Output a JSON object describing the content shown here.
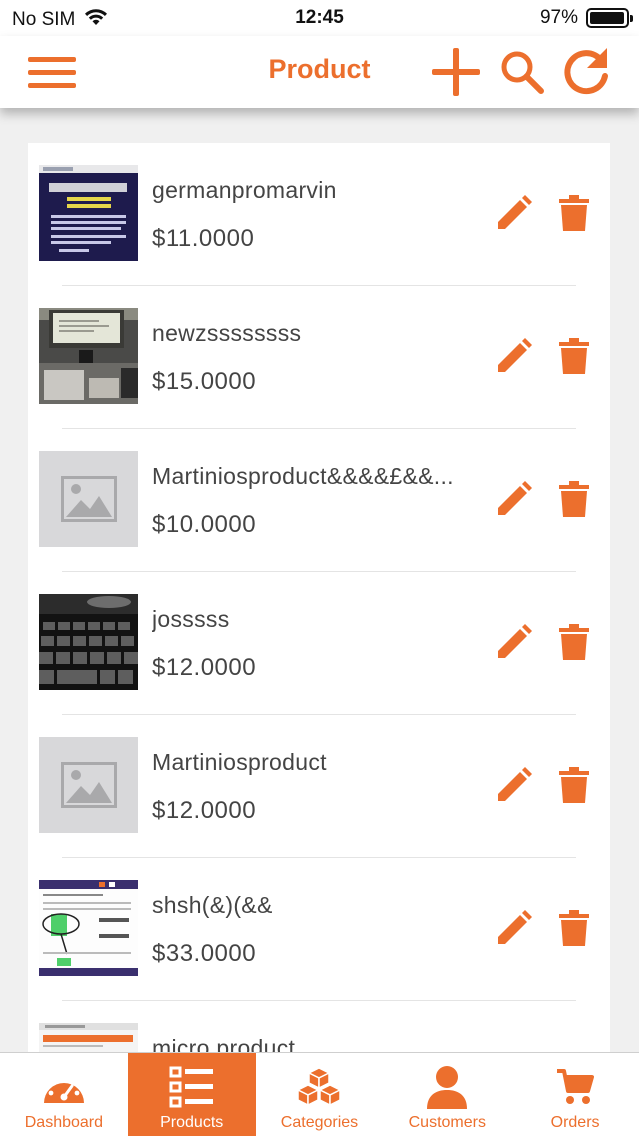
{
  "colors": {
    "accent": "#ec6f2d",
    "text": "#444444",
    "placeholder_bg": "#d8d8da"
  },
  "status_bar": {
    "carrier": "No SIM",
    "time": "12:45",
    "battery": "97%",
    "battery_level": 0.97
  },
  "nav": {
    "title": "Product",
    "icons": [
      "menu-icon",
      "add-icon",
      "search-icon",
      "refresh-icon"
    ]
  },
  "products": [
    {
      "name": "germanpromarvin",
      "price": "$11.0000",
      "image": "screenshot-dark-blue"
    },
    {
      "name": "newzssssssss",
      "price": "$15.0000",
      "image": "photo-monitor-desk"
    },
    {
      "name": "Martiniosproduct&&&&£&&...",
      "price": "$10.0000",
      "image": "placeholder-icon"
    },
    {
      "name": "josssss",
      "price": "$12.0000",
      "image": "photo-keyboard"
    },
    {
      "name": "Martiniosproduct",
      "price": "$12.0000",
      "image": "placeholder-icon"
    },
    {
      "name": "shsh(&)(&&",
      "price": "$33.0000",
      "image": "screenshot-app-drawing"
    },
    {
      "name": "micro product",
      "price": "",
      "image": "screenshot-app"
    }
  ],
  "tabs": [
    {
      "label": "Dashboard",
      "icon": "speedometer-icon",
      "active": false
    },
    {
      "label": "Products",
      "icon": "list-icon",
      "active": true
    },
    {
      "label": "Categories",
      "icon": "boxes-icon",
      "active": false
    },
    {
      "label": "Customers",
      "icon": "person-icon",
      "active": false
    },
    {
      "label": "Orders",
      "icon": "cart-icon",
      "active": false
    }
  ]
}
